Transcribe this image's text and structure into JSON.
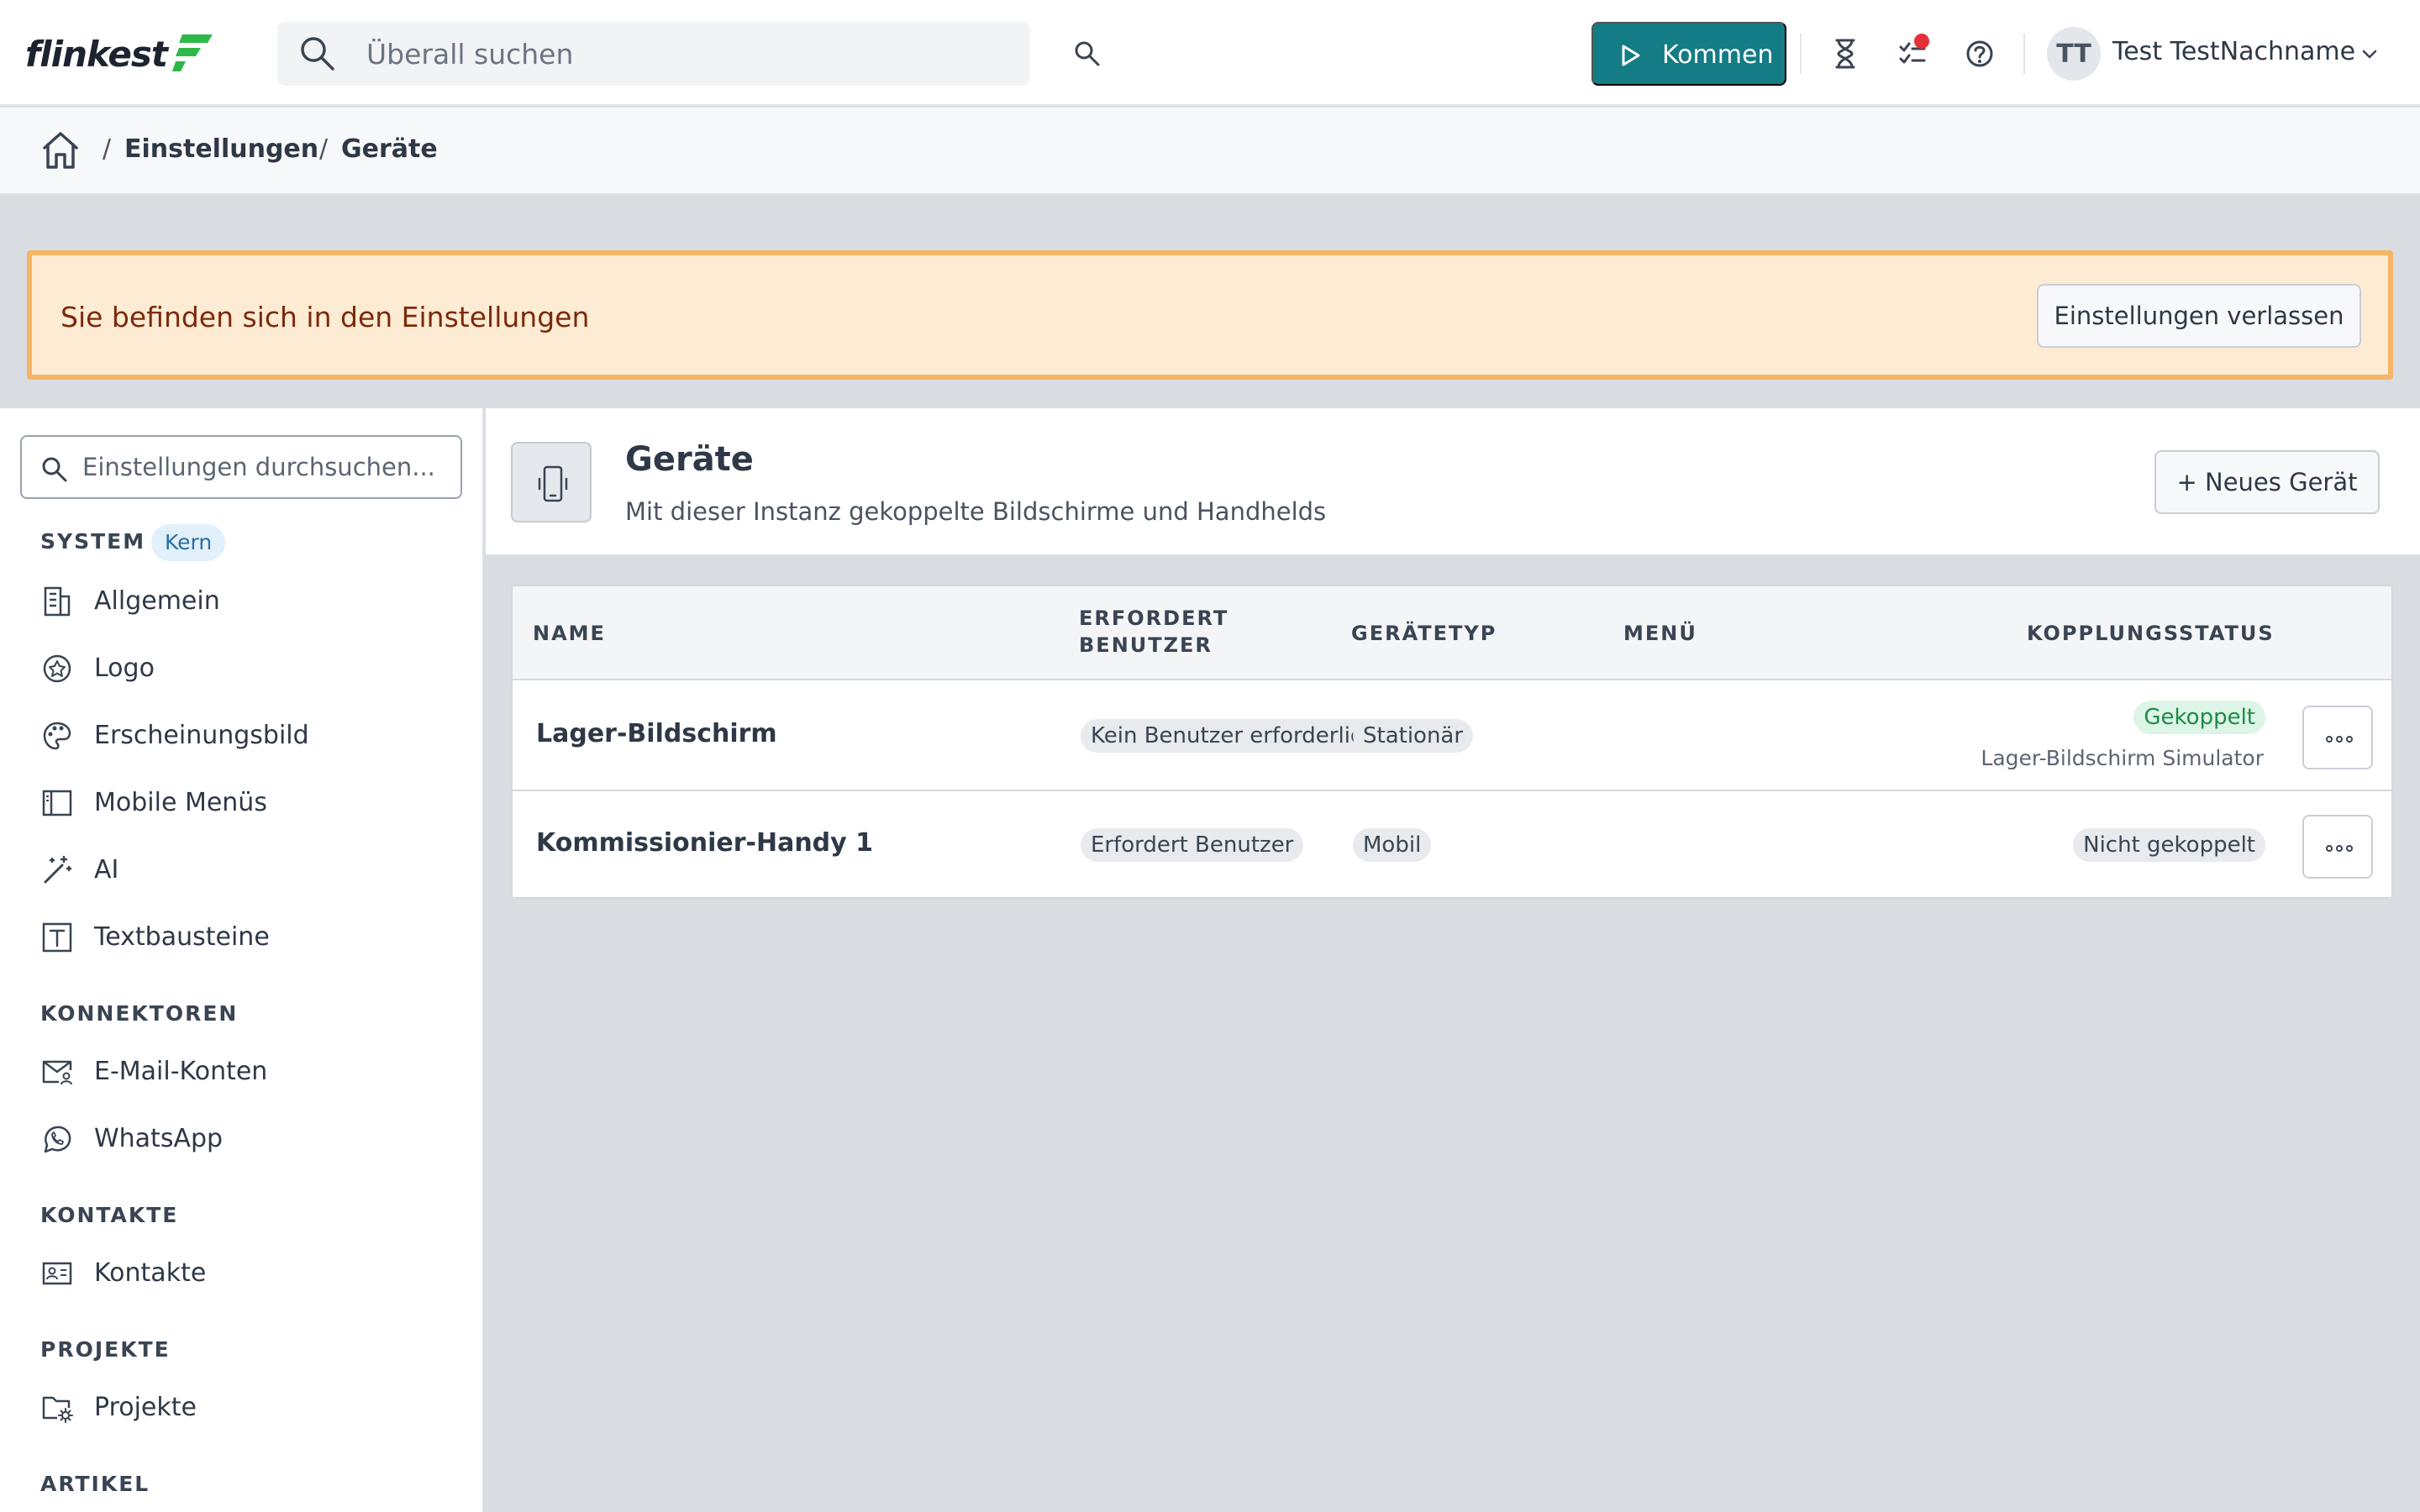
{
  "app": {
    "logo_text": "flinkest"
  },
  "topbar": {
    "search_placeholder": "Überall suchen",
    "kommen_label": "Kommen",
    "user": {
      "initials": "TT",
      "name": "Test TestNachname"
    }
  },
  "breadcrumb": {
    "items": [
      "Einstellungen",
      "Geräte"
    ]
  },
  "banner": {
    "text": "Sie befinden sich in den Einstellungen",
    "button": "Einstellungen verlassen"
  },
  "sidebar": {
    "search_placeholder": "Einstellungen durchsuchen...",
    "sections": [
      {
        "title": "SYSTEM",
        "badge": "Kern",
        "items": [
          {
            "label": "Allgemein",
            "icon": "building-icon"
          },
          {
            "label": "Logo",
            "icon": "badge-icon"
          },
          {
            "label": "Erscheinungsbild",
            "icon": "palette-icon"
          },
          {
            "label": "Mobile Menüs",
            "icon": "sidebar-layout-icon"
          },
          {
            "label": "AI",
            "icon": "magic-wand-icon"
          },
          {
            "label": "Textbausteine",
            "icon": "text-icon"
          }
        ]
      },
      {
        "title": "KONNEKTOREN",
        "items": [
          {
            "label": "E-Mail-Konten",
            "icon": "mail-user-icon"
          },
          {
            "label": "WhatsApp",
            "icon": "whatsapp-icon"
          }
        ]
      },
      {
        "title": "KONTAKTE",
        "items": [
          {
            "label": "Kontakte",
            "icon": "contact-card-icon"
          }
        ]
      },
      {
        "title": "PROJEKTE",
        "items": [
          {
            "label": "Projekte",
            "icon": "folder-gear-icon"
          }
        ]
      },
      {
        "title": "ARTIKEL",
        "items": []
      }
    ]
  },
  "main": {
    "title": "Geräte",
    "subtitle": "Mit dieser Instanz gekoppelte Bildschirme und Handhelds",
    "new_button": "+ Neues Gerät"
  },
  "table": {
    "columns": [
      "NAME",
      "ERFORDERT\nBENUTZER",
      "GERÄTETYP",
      "MENÜ",
      "KOPPLUNGSSTATUS"
    ],
    "col_erfordert_1": "ERFORDERT",
    "col_erfordert_2": "BENUTZER",
    "rows": [
      {
        "name": "Lager-Bildschirm",
        "requires_user": "Kein Benutzer erforderlich",
        "type": "Stationär",
        "menu": "",
        "status": "Gekoppelt",
        "status_detail": "Lager-Bildschirm Simulator"
      },
      {
        "name": "Kommissionier-Handy 1",
        "requires_user": "Erfordert Benutzer",
        "type": "Mobil",
        "menu": "",
        "status": "Nicht gekoppelt",
        "status_detail": ""
      }
    ]
  },
  "colors": {
    "accent": "#137c84",
    "banner_bg": "#feebd4",
    "banner_border": "#f5b566",
    "status_ok": "#1f8a49",
    "notification": "#e5303a"
  }
}
